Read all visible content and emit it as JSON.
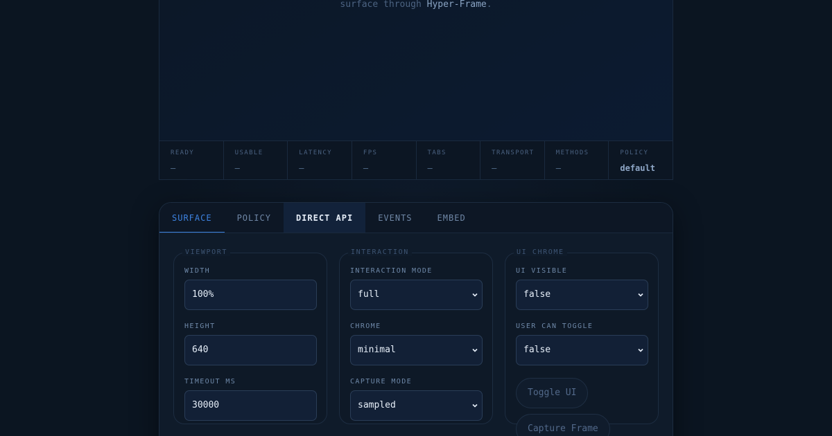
{
  "surface": {
    "caption_prefix": "surface through ",
    "caption_highlight": "Hyper-Frame",
    "caption_suffix": "."
  },
  "stats": [
    {
      "label": "READY",
      "value": "—"
    },
    {
      "label": "USABLE",
      "value": "—"
    },
    {
      "label": "LATENCY",
      "value": "—"
    },
    {
      "label": "FPS",
      "value": "—"
    },
    {
      "label": "TABS",
      "value": "—"
    },
    {
      "label": "TRANSPORT",
      "value": "—"
    },
    {
      "label": "METHODS",
      "value": "—"
    },
    {
      "label": "POLICY",
      "value": "default"
    }
  ],
  "tabs": [
    {
      "label": "SURFACE",
      "state": "active"
    },
    {
      "label": "POLICY",
      "state": "normal"
    },
    {
      "label": "DIRECT API",
      "state": "selected"
    },
    {
      "label": "EVENTS",
      "state": "normal"
    },
    {
      "label": "EMBED",
      "state": "normal"
    }
  ],
  "viewport": {
    "legend": "VIEWPORT",
    "width_label": "WIDTH",
    "width_value": "100%",
    "height_label": "HEIGHT",
    "height_value": "640",
    "timeout_label": "TIMEOUT MS",
    "timeout_value": "30000"
  },
  "interaction": {
    "legend": "INTERACTION",
    "mode_label": "INTERACTION MODE",
    "mode_value": "full",
    "chrome_label": "CHROME",
    "chrome_value": "minimal",
    "capture_label": "CAPTURE MODE",
    "capture_value": "sampled"
  },
  "ui_chrome": {
    "legend": "UI CHROME",
    "visible_label": "UI VISIBLE",
    "visible_value": "false",
    "toggle_label": "USER CAN TOGGLE",
    "toggle_value": "false",
    "toggle_button": "Toggle UI",
    "capture_button": "Capture Frame"
  },
  "colors": {
    "accent": "#3d82e0",
    "background": "#0b1521",
    "panel": "#0f1b2a"
  },
  "icons": {
    "select_arrow": "chevron-down-icon"
  }
}
